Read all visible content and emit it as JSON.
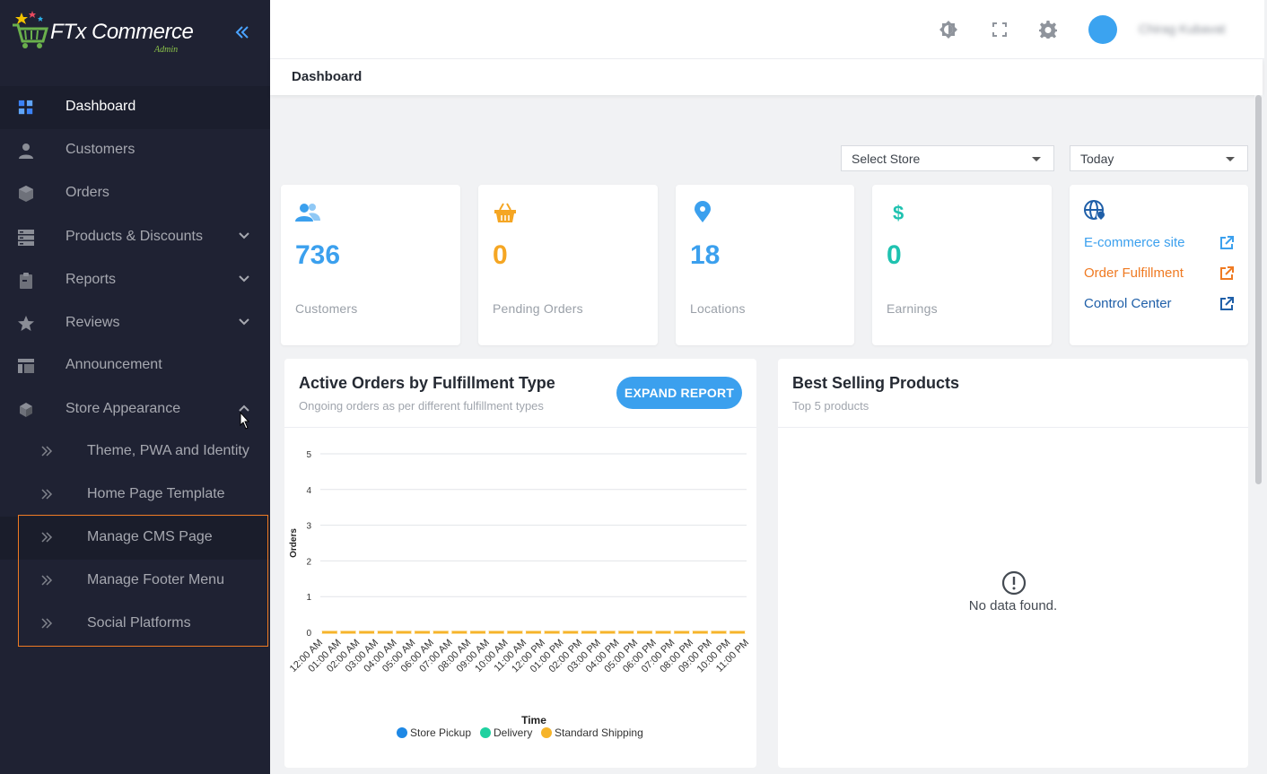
{
  "brand": {
    "name": "FTx Commerce",
    "sub": "Admin"
  },
  "sidebar": {
    "items": [
      {
        "label": "Dashboard",
        "icon": "dashboard-grid-icon",
        "active": true
      },
      {
        "label": "Customers",
        "icon": "person-icon"
      },
      {
        "label": "Orders",
        "icon": "box-icon"
      },
      {
        "label": "Products & Discounts",
        "icon": "server-stack-icon",
        "expandable": true
      },
      {
        "label": "Reports",
        "icon": "clipboard-icon",
        "expandable": true
      },
      {
        "label": "Reviews",
        "icon": "star-icon",
        "expandable": true
      },
      {
        "label": "Announcement",
        "icon": "layout-icon"
      },
      {
        "label": "Store Appearance",
        "icon": "cube-icon",
        "expanded": true
      }
    ],
    "sub_items": [
      {
        "label": "Theme, PWA and Identity"
      },
      {
        "label": "Home Page Template"
      },
      {
        "label": "Manage CMS Page"
      },
      {
        "label": "Manage Footer Menu"
      },
      {
        "label": "Social Platforms"
      }
    ]
  },
  "header": {
    "user_name": "Chirag Kubavat",
    "icons": [
      "brightness-icon",
      "fullscreen-icon",
      "settings-gear-icon"
    ]
  },
  "page": {
    "title": "Dashboard"
  },
  "filters": {
    "store": "Select Store",
    "period": "Today"
  },
  "stats": [
    {
      "value": "736",
      "label": "Customers",
      "color": "#3ba0ee"
    },
    {
      "value": "0",
      "label": "Pending Orders",
      "color": "#f5a623"
    },
    {
      "value": "18",
      "label": "Locations",
      "color": "#3ba0ee"
    },
    {
      "value": "0",
      "label": "Earnings",
      "color": "#1fc2b0"
    }
  ],
  "quick_links": [
    {
      "label": "E-commerce site",
      "color": "#3ba0ee"
    },
    {
      "label": "Order Fulfillment",
      "color": "#ef7a22"
    },
    {
      "label": "Control Center",
      "color": "#1f5fa8"
    }
  ],
  "active_orders_panel": {
    "title": "Active Orders by Fulfillment Type",
    "subtitle": "Ongoing orders as per different fulfillment types",
    "button": "EXPAND REPORT"
  },
  "best_selling_panel": {
    "title": "Best Selling Products",
    "subtitle": "Top 5 products",
    "empty_text": "No data found."
  },
  "chart_data": {
    "type": "line",
    "xlabel": "Time",
    "ylabel": "Orders",
    "ylim": [
      0,
      5
    ],
    "yticks": [
      "0",
      "1",
      "2",
      "3",
      "4",
      "5"
    ],
    "categories": [
      "12:00 AM",
      "01:00 AM",
      "02:00 AM",
      "03:00 AM",
      "04:00 AM",
      "05:00 AM",
      "06:00 AM",
      "07:00 AM",
      "08:00 AM",
      "09:00 AM",
      "10:00 AM",
      "11:00 AM",
      "12:00 PM",
      "01:00 PM",
      "02:00 PM",
      "03:00 PM",
      "04:00 PM",
      "05:00 PM",
      "06:00 PM",
      "07:00 PM",
      "08:00 PM",
      "09:00 PM",
      "10:00 PM",
      "11:00 PM"
    ],
    "series": [
      {
        "name": "Store Pickup",
        "color": "#1e88e5",
        "values": [
          0,
          0,
          0,
          0,
          0,
          0,
          0,
          0,
          0,
          0,
          0,
          0,
          0,
          0,
          0,
          0,
          0,
          0,
          0,
          0,
          0,
          0,
          0,
          0
        ]
      },
      {
        "name": "Delivery",
        "color": "#1fd1a0",
        "values": [
          0,
          0,
          0,
          0,
          0,
          0,
          0,
          0,
          0,
          0,
          0,
          0,
          0,
          0,
          0,
          0,
          0,
          0,
          0,
          0,
          0,
          0,
          0,
          0
        ]
      },
      {
        "name": "Standard Shipping",
        "color": "#f6b42a",
        "values": [
          0,
          0,
          0,
          0,
          0,
          0,
          0,
          0,
          0,
          0,
          0,
          0,
          0,
          0,
          0,
          0,
          0,
          0,
          0,
          0,
          0,
          0,
          0,
          0
        ]
      }
    ],
    "legend": "bottom",
    "grid": true
  }
}
